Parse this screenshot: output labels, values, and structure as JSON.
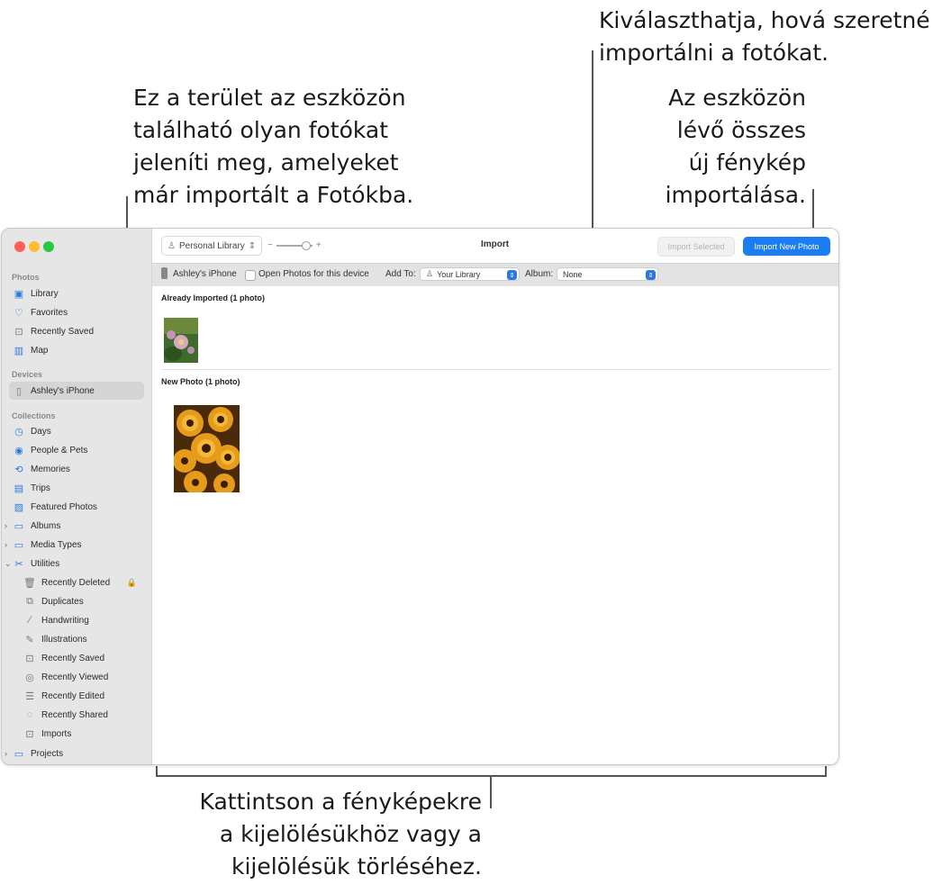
{
  "callouts": {
    "top_left": "Ez a terület az eszközön\ntalálható olyan fotókat\njeleníti meg, amelyeket\nmár importált a Fotókba.",
    "top_middle": "Kiválaszthatja, hová szeretné\nimportálni a fotókat.",
    "top_right": "Az eszközön\nlévő összes\núj fénykép\nimportálása.",
    "bottom": "Kattintson a fényképekre\na kijelölésükhöz vagy a\nkijelölésük törléséhez."
  },
  "window": {
    "title": "Import",
    "library_button": "Personal Library",
    "import_selected": "Import Selected",
    "import_new": "Import New Photo"
  },
  "device_bar": {
    "device": "Ashley's iPhone",
    "open_photos": "Open Photos for this device",
    "add_to_label": "Add To:",
    "add_to_value": "Your Library",
    "album_label": "Album:",
    "album_value": "None"
  },
  "sidebar": {
    "photos_header": "Photos",
    "library": "Library",
    "favorites": "Favorites",
    "recently_saved": "Recently Saved",
    "map": "Map",
    "devices_header": "Devices",
    "device_item": "Ashley's iPhone",
    "collections_header": "Collections",
    "days": "Days",
    "people_pets": "People & Pets",
    "memories": "Memories",
    "trips": "Trips",
    "featured_photos": "Featured Photos",
    "albums": "Albums",
    "media_types": "Media Types",
    "utilities": "Utilities",
    "recently_deleted": "Recently Deleted",
    "duplicates": "Duplicates",
    "handwriting": "Handwriting",
    "illustrations": "Illustrations",
    "u_recently_saved": "Recently Saved",
    "recently_viewed": "Recently Viewed",
    "recently_edited": "Recently Edited",
    "recently_shared": "Recently Shared",
    "imports": "Imports",
    "projects": "Projects"
  },
  "content": {
    "already_imported": "Already Imported (1 photo)",
    "new_photo": "New Photo (1 photo)"
  },
  "colors": {
    "accent": "#1c7cf2",
    "sidebar_bg": "#e7e6e6"
  }
}
